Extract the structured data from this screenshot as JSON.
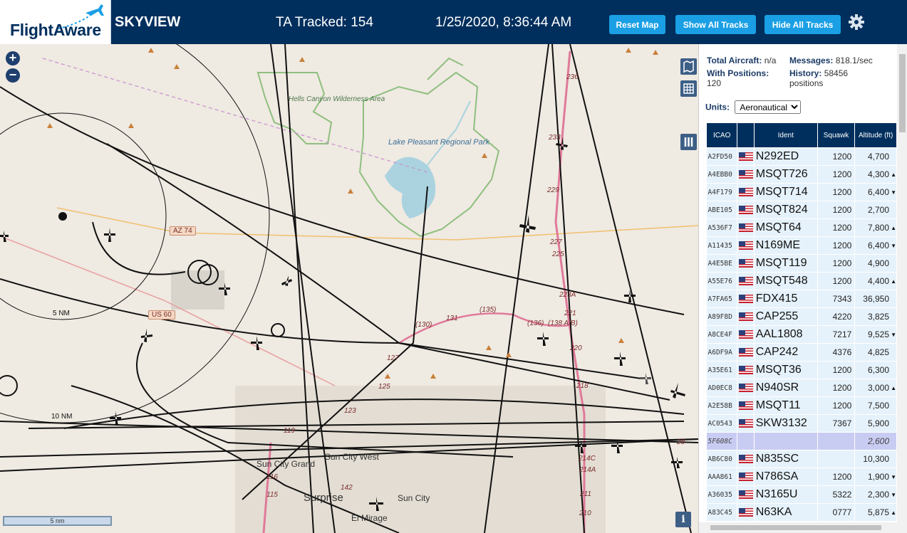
{
  "header": {
    "logo_text": "FlightAware",
    "app_title": "SKYVIEW",
    "tracked": "TA Tracked: 154",
    "datetime": "1/25/2020, 8:36:44 AM",
    "reset_label": "Reset Map",
    "show_label": "Show All Tracks",
    "hide_label": "Hide All Tracks"
  },
  "map": {
    "zoom_in": "+",
    "zoom_out": "−",
    "scale_label": "5 nm",
    "info_label": "i",
    "labels": {
      "hells_canyon": "Hells Canyon Wilderness Area",
      "lake_pleasant": "Lake Pleasant Regional Park",
      "az74": "AZ 74",
      "us60": "US 60",
      "ring5": "5 NM",
      "ring10": "10 NM",
      "sun_city_grand": "Sun City Grand",
      "sun_city_west": "Sun City West",
      "sun_city": "Sun City",
      "surprise": "Surprise",
      "el_mirage": "El Mirage",
      "h130": "(130)",
      "h131": "131",
      "h135": "(135)",
      "h136": "(136)",
      "h138": "(138 A/B)",
      "h236": "236",
      "h233": "233",
      "h229": "229",
      "h227": "227",
      "h225": "225",
      "h223a": "223A",
      "h221": "221",
      "h220": "220",
      "h218": "218",
      "h214c": "214C",
      "h214a": "214A",
      "h211": "211",
      "h210": "210",
      "h127": "127",
      "h125": "125",
      "h123": "123",
      "h119": "119",
      "h116": "116",
      "h115": "115",
      "h142": "142",
      "h28": "28"
    }
  },
  "sidebar": {
    "total_aircraft_label": "Total Aircraft:",
    "total_aircraft_value": "n/a",
    "messages_label": "Messages:",
    "messages_value": "818.1/sec",
    "with_positions_label": "With Positions:",
    "with_positions_value": "120",
    "history_label": "History:",
    "history_value": "58456 positions",
    "units_label": "Units:",
    "units_value": "Aeronautical",
    "columns": {
      "icao": "ICAO",
      "ident": "Ident",
      "squawk": "Squawk",
      "altitude": "Altitude (ft)"
    },
    "rows": [
      {
        "icao": "A2FD50",
        "ident": "N292ED",
        "squawk": "1200",
        "altitude": "4,700",
        "trend": ""
      },
      {
        "icao": "A4EBB0",
        "ident": "MSQT726",
        "squawk": "1200",
        "altitude": "4,300",
        "trend": "▲"
      },
      {
        "icao": "A4F179",
        "ident": "MSQT714",
        "squawk": "1200",
        "altitude": "6,400",
        "trend": "▼"
      },
      {
        "icao": "ABE105",
        "ident": "MSQT824",
        "squawk": "1200",
        "altitude": "2,700",
        "trend": ""
      },
      {
        "icao": "A536F7",
        "ident": "MSQT64",
        "squawk": "1200",
        "altitude": "7,800",
        "trend": "▲"
      },
      {
        "icao": "A11435",
        "ident": "N169ME",
        "squawk": "1200",
        "altitude": "6,400",
        "trend": "▼"
      },
      {
        "icao": "A4E5BE",
        "ident": "MSQT119",
        "squawk": "1200",
        "altitude": "4,900",
        "trend": ""
      },
      {
        "icao": "A55E76",
        "ident": "MSQT548",
        "squawk": "1200",
        "altitude": "4,400",
        "trend": "▲"
      },
      {
        "icao": "A7FA65",
        "ident": "FDX415",
        "squawk": "7343",
        "altitude": "36,950",
        "trend": ""
      },
      {
        "icao": "A89F8D",
        "ident": "CAP255",
        "squawk": "4220",
        "altitude": "3,825",
        "trend": ""
      },
      {
        "icao": "A8CE4F",
        "ident": "AAL1808",
        "squawk": "7217",
        "altitude": "9,525",
        "trend": "▼"
      },
      {
        "icao": "A6DF9A",
        "ident": "CAP242",
        "squawk": "4376",
        "altitude": "4,825",
        "trend": ""
      },
      {
        "icao": "A35E61",
        "ident": "MSQT36",
        "squawk": "1200",
        "altitude": "6,300",
        "trend": ""
      },
      {
        "icao": "AD0EC8",
        "ident": "N940SR",
        "squawk": "1200",
        "altitude": "3,000",
        "trend": "▲"
      },
      {
        "icao": "A2E58B",
        "ident": "MSQT11",
        "squawk": "1200",
        "altitude": "7,500",
        "trend": ""
      },
      {
        "icao": "AC0543",
        "ident": "SKW3132",
        "squawk": "7367",
        "altitude": "5,900",
        "trend": ""
      },
      {
        "icao": "5F608C",
        "ident": "",
        "squawk": "",
        "altitude": "2,600",
        "trend": "",
        "highlight": true
      },
      {
        "icao": "AB6C80",
        "ident": "N835SC",
        "squawk": "",
        "altitude": "10,300",
        "trend": ""
      },
      {
        "icao": "AAA861",
        "ident": "N786SA",
        "squawk": "1200",
        "altitude": "1,900",
        "trend": "▼"
      },
      {
        "icao": "A36035",
        "ident": "N3165U",
        "squawk": "5322",
        "altitude": "2,300",
        "trend": "▼"
      },
      {
        "icao": "A83C45",
        "ident": "N63KA",
        "squawk": "0777",
        "altitude": "5,875",
        "trend": "▲"
      }
    ]
  },
  "colors": {
    "header_bg": "#002f5d",
    "button_blue": "#1a9fe5",
    "map_bg": "#efeae2",
    "row_bg": "#e6f2fb",
    "row_highlight": "#c9ccf2",
    "freeway": "#e07a9a"
  }
}
